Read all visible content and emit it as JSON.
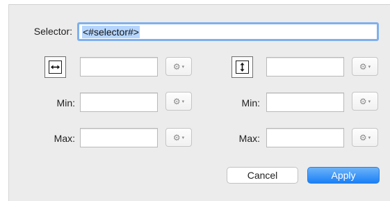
{
  "dialog": {
    "selector_label": "Selector:",
    "selector_value": "<#selector#>",
    "width_column": {
      "toggle_icon": "horizontal-resize-icon",
      "min_label": "Min:",
      "max_label": "Max:"
    },
    "height_column": {
      "toggle_icon": "vertical-resize-icon",
      "min_label": "Min:",
      "max_label": "Max:"
    },
    "gear_icon": "gear-icon",
    "gear_glyph": "⚙",
    "caret_glyph": "▾",
    "cancel_label": "Cancel",
    "apply_label": "Apply"
  },
  "colors": {
    "sheet_background": "#ececec",
    "focus_ring": "#7fb0ec",
    "text_selection": "#b5d5fd",
    "apply_button": "#1b80f6"
  }
}
